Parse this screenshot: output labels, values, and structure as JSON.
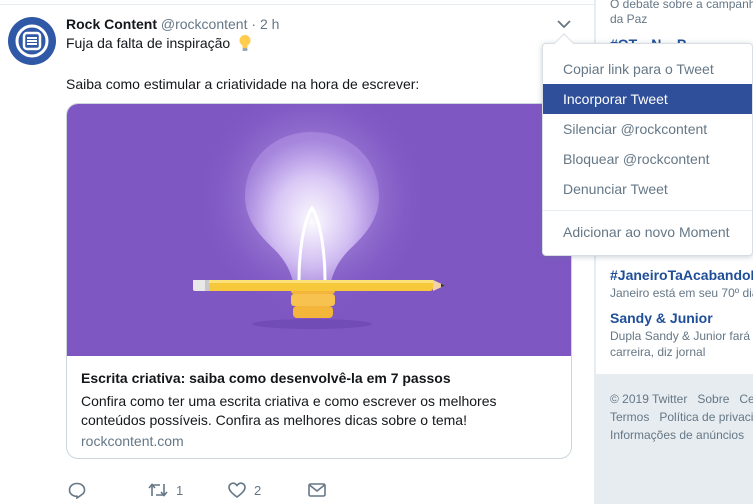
{
  "colors": {
    "accent": "#2f4f9a",
    "link": "#1f4e99",
    "card_bg": "#7e57c2",
    "muted": "#657786"
  },
  "tweet": {
    "author_name": "Rock Content",
    "author_handle": "@rockcontent",
    "separator": "·",
    "time": "2 h",
    "text_line1": "Fuja da falta de inspiração",
    "text_line1_emoji": "light-bulb-icon",
    "text_line2": "Saiba como estimular a criatividade na hora de escrever:",
    "card": {
      "image_icon": "light-bulb-and-pencil-illustration",
      "title": "Escrita criativa: saiba como desenvolvê-la em 7 passos",
      "description": "Confira como ter uma escrita criativa e como escrever os melhores conteúdos possíveis. Confira as melhores dicas sobre o tema!",
      "domain": "rockcontent.com"
    },
    "actions": {
      "reply_icon": "reply-icon",
      "retweet_icon": "retweet-icon",
      "retweet_count": "1",
      "like_icon": "heart-icon",
      "like_count": "2",
      "dm_icon": "envelope-icon"
    }
  },
  "menu": {
    "items": [
      {
        "label": "Copiar link para o Tweet"
      },
      {
        "label": "Incorporar Tweet",
        "highlighted": true
      },
      {
        "label": "Silenciar @rockcontent"
      },
      {
        "label": "Bloquear @rockcontent"
      },
      {
        "label": "Denunciar Tweet"
      },
      {
        "label": "Adicionar ao novo Moment"
      }
    ]
  },
  "sidebar": {
    "trend_top_desc_1": "O debate sobre a campanh",
    "trend_top_desc_2": "da Paz",
    "trend_partial": "#OT... N... P...",
    "trends": [
      {
        "tag": "#JaneiroTaAcabandoE",
        "desc": [
          "Janeiro está em seu 70º dia"
        ]
      },
      {
        "tag": "Sandy & Junior",
        "desc": [
          "Dupla Sandy & Junior fará",
          "carreira, diz jornal"
        ]
      }
    ],
    "footer": {
      "copyright": "© 2019 Twitter",
      "about": "Sobre",
      "center": "Ce",
      "terms": "Termos",
      "privacy": "Política de privaci",
      "ads": "Informações de anúncios"
    }
  }
}
